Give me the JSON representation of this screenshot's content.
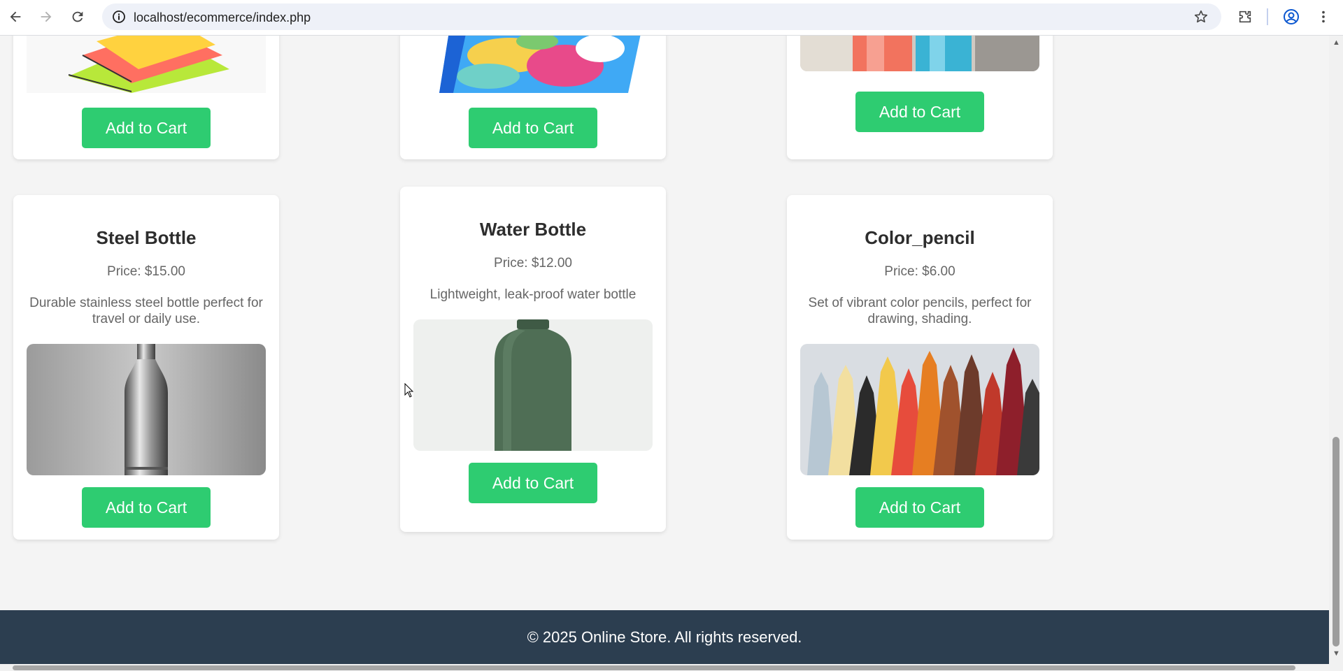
{
  "browser": {
    "url": "localhost/ecommerce/index.php"
  },
  "top_row": [
    {
      "button": "Add to Cart"
    },
    {
      "button": "Add to Cart"
    },
    {
      "button": "Add to Cart"
    }
  ],
  "products": [
    {
      "name": "Steel Bottle",
      "price": "Price: $15.00",
      "description": "Durable stainless steel bottle perfect for travel or daily use.",
      "button": "Add to Cart"
    },
    {
      "name": "Water Bottle",
      "price": "Price: $12.00",
      "description": "Lightweight, leak-proof water bottle",
      "button": "Add to Cart"
    },
    {
      "name": "Color_pencil",
      "price": "Price: $6.00",
      "description": "Set of vibrant color pencils, perfect for drawing, shading.",
      "button": "Add to Cart"
    }
  ],
  "footer": {
    "text": "© 2025 Online Store. All rights reserved."
  },
  "colors": {
    "accent": "#2ecc71",
    "footer_bg": "#2c3e50",
    "page_bg": "#f4f4f4"
  }
}
